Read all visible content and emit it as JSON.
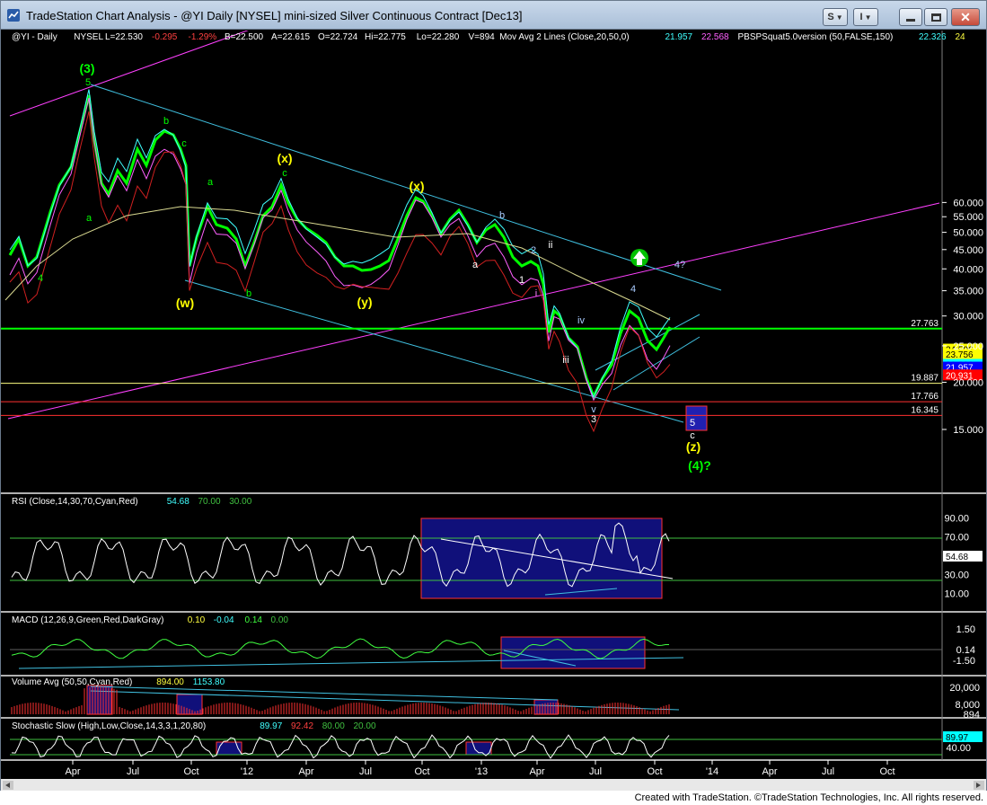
{
  "window": {
    "title": "TradeStation Chart Analysis - @YI Daily [NYSEL] mini-sized Silver Continuous Contract [Dec13]"
  },
  "toolbar": {
    "s_label": "S",
    "i_label": "I"
  },
  "footer": {
    "text": "Created with TradeStation. ©TradeStation Technologies, Inc. All rights reserved."
  },
  "price_header": [
    {
      "t": "@YI - Daily",
      "c": "#ffffff"
    },
    {
      "t": "NYSEL",
      "c": "#ffffff"
    },
    {
      "t": "L=22.530",
      "c": "#ffffff"
    },
    {
      "t": "-0.295",
      "c": "#ff4040"
    },
    {
      "t": "-1.29%",
      "c": "#ff4040"
    },
    {
      "t": "B=22.500",
      "c": "#ffffff"
    },
    {
      "t": "A=22.615",
      "c": "#ffffff"
    },
    {
      "t": "O=22.724",
      "c": "#ffffff"
    },
    {
      "t": "Hi=22.775",
      "c": "#ffffff"
    },
    {
      "t": "Lo=22.280",
      "c": "#ffffff"
    },
    {
      "t": "V=894",
      "c": "#ffffff"
    },
    {
      "t": "Mov Avg 2 Lines (Close,20,50,0)",
      "c": "#ffffff"
    },
    {
      "t": "21.957",
      "c": "#40ffff"
    },
    {
      "t": "22.568",
      "c": "#ff60ff"
    },
    {
      "t": "PBSPSquat5.0version (50,FALSE,150)",
      "c": "#ffffff"
    },
    {
      "t": "22.326",
      "c": "#40ffff"
    },
    {
      "t": "24",
      "c": "#ffff40"
    }
  ],
  "rsi_header": [
    {
      "t": "RSI (Close,14,30,70,Cyan,Red)",
      "c": "#ffffff"
    },
    {
      "t": "54.68",
      "c": "#40ffff"
    },
    {
      "t": "70.00",
      "c": "#40c040"
    },
    {
      "t": "30.00",
      "c": "#40c040"
    }
  ],
  "macd_header": [
    {
      "t": "MACD (12,26,9,Green,Red,DarkGray)",
      "c": "#ffffff"
    },
    {
      "t": "0.10",
      "c": "#ffff40"
    },
    {
      "t": "-0.04",
      "c": "#40ffff"
    },
    {
      "t": "0.14",
      "c": "#40ff40"
    },
    {
      "t": "0.00",
      "c": "#40c040"
    }
  ],
  "volume_header": [
    {
      "t": "Volume Avg (50,50,Cyan,Red)",
      "c": "#ffffff"
    },
    {
      "t": "894.00",
      "c": "#ffff40"
    },
    {
      "t": "1153.80",
      "c": "#40ffff"
    }
  ],
  "stoch_header": [
    {
      "t": "Stochastic Slow (High,Low,Close,14,3,3,1,20,80)",
      "c": "#ffffff"
    },
    {
      "t": "89.97",
      "c": "#40ffff"
    },
    {
      "t": "92.42",
      "c": "#ff4040"
    },
    {
      "t": "80.00",
      "c": "#40c040"
    },
    {
      "t": "20.00",
      "c": "#40c040"
    }
  ],
  "price_axis": [
    "60.000",
    "55.000",
    "50.000",
    "45.000",
    "40.000",
    "35.000",
    "30.000",
    "25.000",
    "20.000",
    "15.000"
  ],
  "price_axis_values": [
    60,
    55,
    50,
    45,
    40,
    35,
    30,
    25,
    20,
    15
  ],
  "price_levels": [
    {
      "label": "27.763",
      "value": 27.763,
      "color": "#00ff00"
    },
    {
      "label": "19.887",
      "value": 19.887,
      "color": "#ffff80"
    },
    {
      "label": "17.766",
      "value": 17.766,
      "color": "#ff3030"
    },
    {
      "label": "16.345",
      "value": 16.345,
      "color": "#ff3030"
    }
  ],
  "price_tags": [
    {
      "label": "24.506",
      "value": 24.506,
      "bg": "#ffff00",
      "fg": "#000000"
    },
    {
      "label": "23.756",
      "value": 23.756,
      "bg": "#ffff00",
      "fg": "#000000"
    },
    {
      "label": "22.330",
      "value": 22.33,
      "bg": "#00ffff",
      "fg": "#000000"
    },
    {
      "label": "21.957",
      "value": 21.957,
      "bg": "#0000ff",
      "fg": "#ffffff"
    },
    {
      "label": "20.931",
      "value": 20.931,
      "bg": "#ff0000",
      "fg": "#ffffff"
    }
  ],
  "rsi_axis": [
    "90.00",
    "70.00",
    "50.00",
    "30.00",
    "10.00"
  ],
  "rsi_axis_values": [
    90,
    70,
    50,
    30,
    10
  ],
  "rsi_tag": "54.68",
  "macd_axis": [
    "1.50",
    "0.14",
    "-1.50"
  ],
  "volume_axis": [
    "20,000",
    "8,000",
    "894"
  ],
  "stoch_axis": [
    "89.97",
    "40.00"
  ],
  "x_axis": [
    "Apr",
    "Jul",
    "Oct",
    "'12",
    "Apr",
    "Jul",
    "Oct",
    "'13",
    "Apr",
    "Jul",
    "Oct",
    "'14",
    "Apr",
    "Jul",
    "Oct"
  ],
  "wave_labels": [
    {
      "t": "(3)",
      "c": "#00ff00",
      "big": true
    },
    {
      "t": "5",
      "c": "#00ff00"
    },
    {
      "t": "4",
      "c": "#00ff00"
    },
    {
      "t": "a",
      "c": "#00ff00"
    },
    {
      "t": "b",
      "c": "#00ff00"
    },
    {
      "t": "c",
      "c": "#00ff00"
    },
    {
      "t": "a",
      "c": "#00ff00"
    },
    {
      "t": "b",
      "c": "#00ff00"
    },
    {
      "t": "(w)",
      "c": "#ffff00",
      "big": true
    },
    {
      "t": "(x)",
      "c": "#ffff00",
      "big": true
    },
    {
      "t": "c",
      "c": "#00ff00"
    },
    {
      "t": "(y)",
      "c": "#ffff00",
      "big": true
    },
    {
      "t": "(x)",
      "c": "#ffff00",
      "big": true
    },
    {
      "t": "a",
      "c": "#ffffff"
    },
    {
      "t": "b",
      "c": "#aaccff"
    },
    {
      "t": "1",
      "c": "#ffffff"
    },
    {
      "t": "2",
      "c": "#aaccff"
    },
    {
      "t": "i",
      "c": "#ff80ff"
    },
    {
      "t": "ii",
      "c": "#ffffff"
    },
    {
      "t": "iii",
      "c": "#ffffff"
    },
    {
      "t": "iv",
      "c": "#aaccff"
    },
    {
      "t": "v",
      "c": "#aaccff"
    },
    {
      "t": "3",
      "c": "#ffffff"
    },
    {
      "t": "4",
      "c": "#aaccff"
    },
    {
      "t": "4?",
      "c": "#aaccff"
    },
    {
      "t": "5",
      "c": "#ffffff"
    },
    {
      "t": "c",
      "c": "#ffffff"
    },
    {
      "t": "(z)",
      "c": "#ffff00",
      "big": true
    },
    {
      "t": "(4)?",
      "c": "#00ff00",
      "big": true
    }
  ],
  "colors": {
    "background": "#000000",
    "price": "#00ff00",
    "ma20": "#40ffff",
    "ma50": "#ff60ff",
    "channel": "#40c0e0",
    "trendline": "#ff40ff",
    "box": "#10107a"
  }
}
